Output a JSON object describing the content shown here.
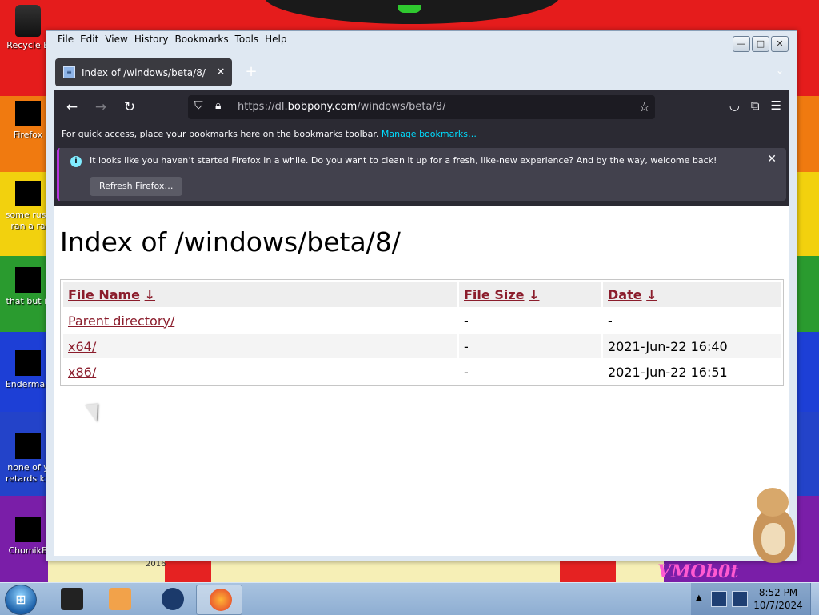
{
  "desktop": {
    "icons": [
      {
        "label": "Recycle B"
      },
      {
        "label": "Firefox"
      },
      {
        "label": "some russ",
        "label2": "ran a ra"
      },
      {
        "label": "that but it"
      },
      {
        "label": "Enderman"
      },
      {
        "label": "none of y",
        "label2": "retards kn"
      },
      {
        "label": "ChomikB"
      }
    ],
    "wallpaper_text": "VMOb0t",
    "wallpaper_year": "2016"
  },
  "window": {
    "menu": [
      "File",
      "Edit",
      "View",
      "History",
      "Bookmarks",
      "Tools",
      "Help"
    ],
    "menu_accel": [
      "F",
      "E",
      "V",
      "H",
      "B",
      "T",
      "H"
    ],
    "controls": {
      "minimize": "—",
      "maximize": "□",
      "close": "✕"
    }
  },
  "browser": {
    "tab": {
      "title": "Index of /windows/beta/8/",
      "close": "✕"
    },
    "newtab": "+",
    "url": {
      "prefix": "https://dl.",
      "domain": "bobpony.com",
      "path": "/windows/beta/8/"
    },
    "bookmarks_bar": {
      "text": "For quick access, place your bookmarks here on the bookmarks toolbar.",
      "link": "Manage bookmarks…"
    },
    "notification": {
      "text": "It looks like you haven’t started Firefox in a while. Do you want to clean it up for a fresh, like-new experience? And by the way, welcome back!",
      "button": "Refresh Firefox…"
    }
  },
  "page": {
    "title": "Index of /windows/beta/8/",
    "columns": [
      "File Name",
      "File Size",
      "Date"
    ],
    "sort_glyph": "↓",
    "rows": [
      {
        "name": "Parent directory/",
        "size": "-",
        "date": "-"
      },
      {
        "name": "x64/",
        "size": "-",
        "date": "2021-Jun-22 16:40"
      },
      {
        "name": "x86/",
        "size": "-",
        "date": "2021-Jun-22 16:51"
      }
    ]
  },
  "taskbar": {
    "clock_time": "8:52 PM",
    "clock_date": "10/7/2024"
  },
  "colors": {
    "link": "#8b1d2c",
    "toolbar_bg": "#2b2a33",
    "notice_accent": "#b833e1"
  }
}
